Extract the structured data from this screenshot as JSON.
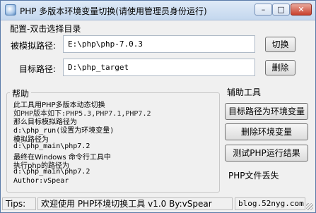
{
  "window": {
    "title": "PHP 多版本环境变量切换(请使用管理员身份运行)",
    "controls": {
      "minimize": "–",
      "maximize": "□",
      "close": "✕"
    }
  },
  "config": {
    "group_title": "配置-双击选择目录",
    "simulated_path": {
      "label": "被模拟路径:",
      "value": "E:\\php\\php-7.0.3",
      "button": "切换"
    },
    "target_path": {
      "label": "目标路径:",
      "value": "D:\\php_target",
      "button": "删除"
    }
  },
  "help": {
    "group_title": "帮助",
    "lines": [
      {
        "text": "此工具用PHP多版本动态切换",
        "style": "cn"
      },
      {
        "text": "如PHP版本如下:PHP5.3,PHP7.1,PHP7.2",
        "style": "mono over"
      },
      {
        "text": "那么目标模拟路径为",
        "style": "cn"
      },
      {
        "text": "d:\\php_run(设置为环境变量)",
        "style": "mono"
      },
      {
        "text": "模拟路径为",
        "style": "cn"
      },
      {
        "text": "d:\\php_main\\php7.2",
        "style": "mono"
      },
      {
        "text": "最终在Windows 命令行工具中",
        "style": "cn"
      },
      {
        "text": "执行php的路径为",
        "style": "cn"
      },
      {
        "text": "d:\\php_main\\php7.2",
        "style": "mono"
      },
      {
        "text": "Author:vSpear",
        "style": "mono"
      }
    ]
  },
  "tools": {
    "group_title": "辅助工具",
    "buttons": [
      "目标路径为环境变量",
      "删除环境变量",
      "测试PHP运行结果"
    ],
    "status": "PHP文件丢失"
  },
  "statusbar": {
    "label": "Tips:",
    "message": "欢迎使用 PHP环境切换工具 v1.0 By:vSpear",
    "site": "blog.52nyg.com"
  }
}
